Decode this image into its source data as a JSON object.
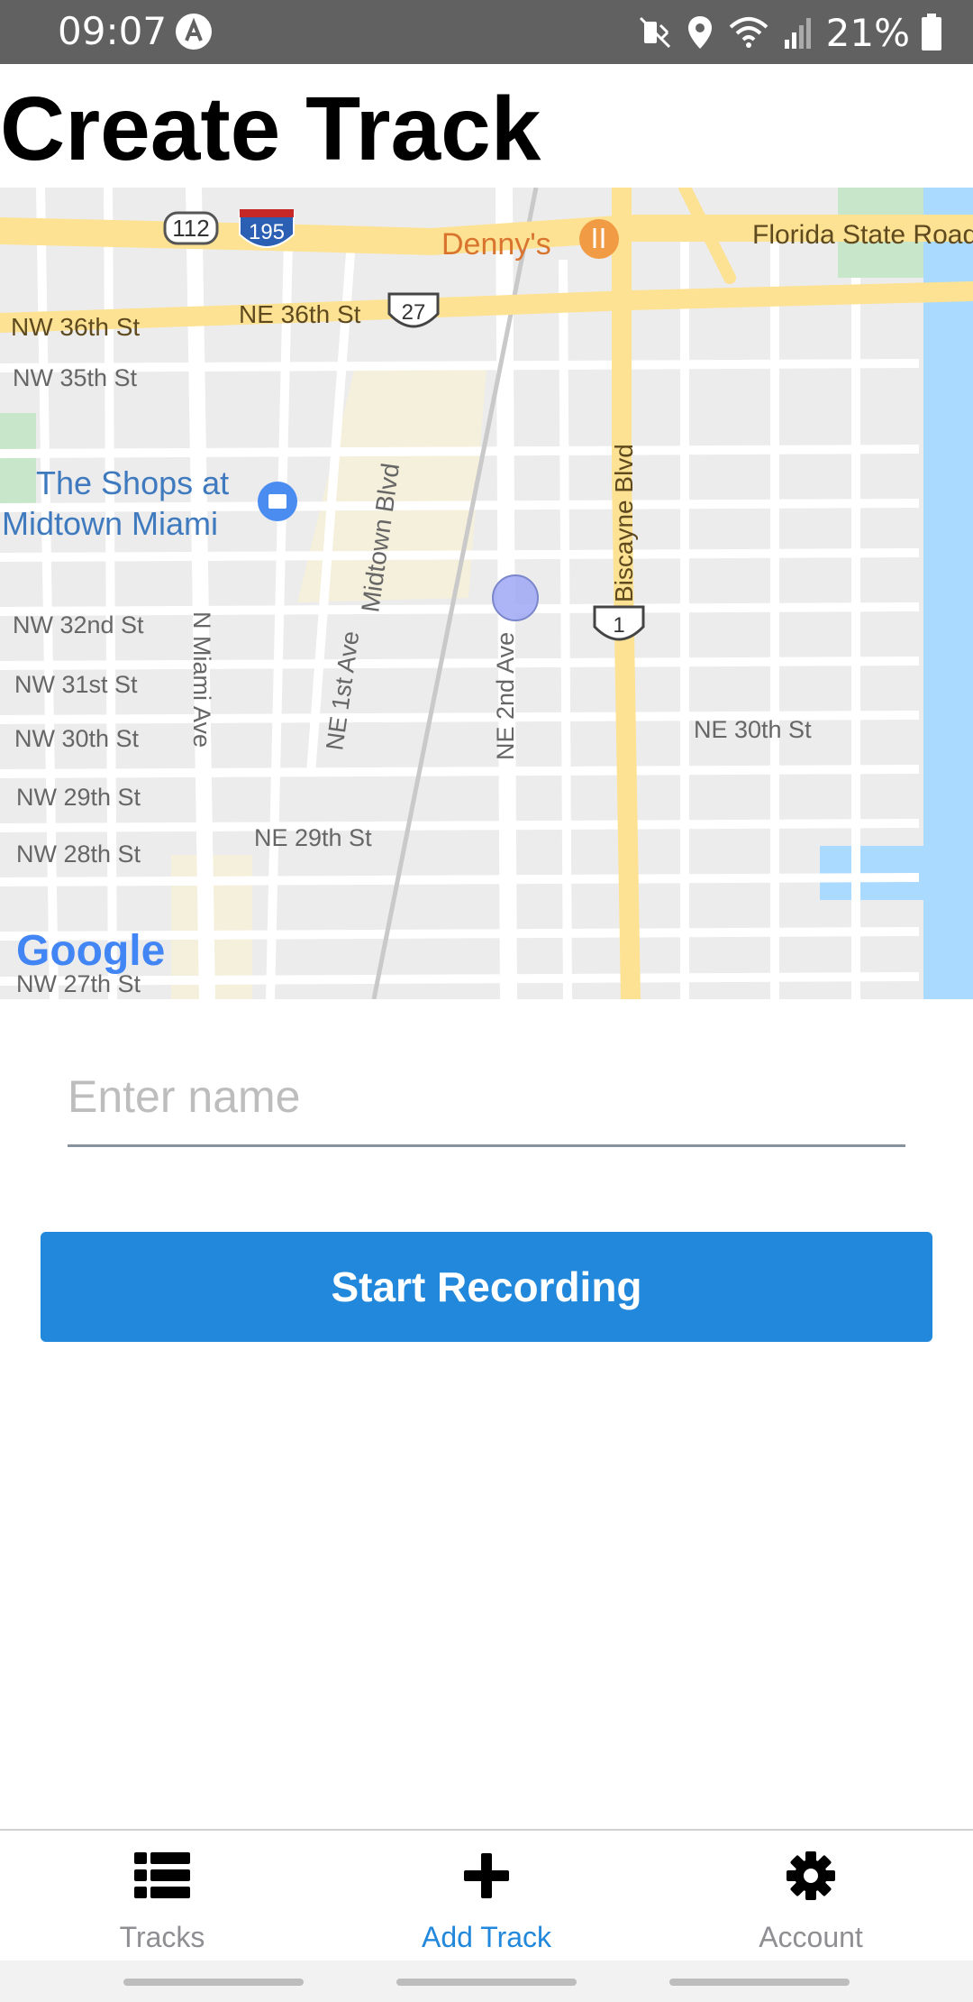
{
  "status_bar": {
    "time": "09:07",
    "battery_text": "21%",
    "icons": [
      "app-icon",
      "mute-icon",
      "location-icon",
      "wifi-icon",
      "signal-icon",
      "battery-icon"
    ]
  },
  "page": {
    "title": "Create Track"
  },
  "map": {
    "attribution": "Google",
    "labels": {
      "denny": "Denny's",
      "florida": "Florida State Road",
      "nw36": "NW 36th St",
      "ne36": "NE 36th St",
      "nw35": "NW 35th St",
      "shops1": "The Shops at",
      "shops2": "Midtown Miami",
      "midtown": "Midtown Blvd",
      "biscayne": "Biscayne Blvd",
      "nw32": "NW 32nd St",
      "nw31": "NW 31st St",
      "nw30": "NW 30th St",
      "nw29": "NW 29th St",
      "nw28": "NW 28th St",
      "nw27": "NW 27th St",
      "ne30": "NE 30th St",
      "ne29": "NE 29th St",
      "nmiami": "N Miami Ave",
      "ne1st": "NE 1st Ave",
      "ne2nd": "NE 2nd Ave",
      "shield112": "112",
      "shield195": "195",
      "shield27": "27",
      "shield1": "1"
    }
  },
  "form": {
    "name_placeholder": "Enter name",
    "name_value": "",
    "start_button_label": "Start Recording"
  },
  "tabs": [
    {
      "label": "Tracks",
      "icon": "list-icon",
      "active": false
    },
    {
      "label": "Add Track",
      "icon": "plus-icon",
      "active": true
    },
    {
      "label": "Account",
      "icon": "gear-icon",
      "active": false
    }
  ],
  "colors": {
    "accent": "#2288dc",
    "inactive_tab": "#8e8e93",
    "status_bar": "#616161",
    "map_road_major": "#fde293",
    "map_water": "#aadaff"
  }
}
